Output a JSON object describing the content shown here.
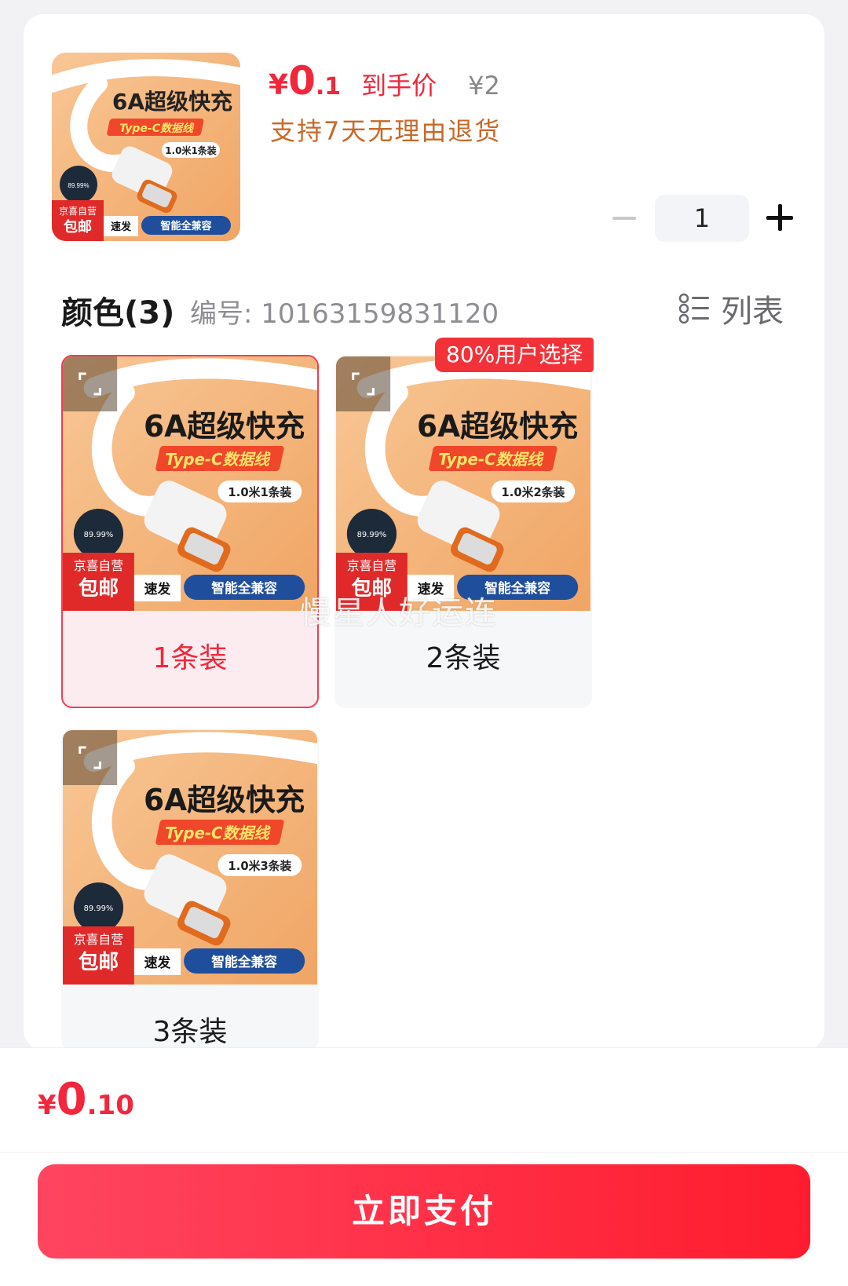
{
  "product": {
    "price_symbol": "¥",
    "price_int": "0",
    "price_dec": ".1",
    "price_tag": "到手价",
    "original_price": "¥2",
    "return_policy": "支持7天无理由退货",
    "quantity": "1",
    "thumb": {
      "title": "6A超级快充",
      "subtitle": "Type-C数据线",
      "spec": "1.0米1条装",
      "badge_top": "京喜自营",
      "badge_bottom": "包邮",
      "left_strip": "速发",
      "right_strip": "智能全兼容",
      "disc_text": "89.99%"
    }
  },
  "selector": {
    "title": "颜色(3)",
    "sku_id": "编号: 10163159831120",
    "list_label": "列表",
    "popular_badge": "80%用户选择",
    "options": [
      {
        "label": "1条装",
        "spec": "1.0米1条装",
        "selected": true
      },
      {
        "label": "2条装",
        "spec": "1.0米2条装",
        "selected": false
      },
      {
        "label": "3条装",
        "spec": "1.0米3条装",
        "selected": false
      }
    ],
    "image_common": {
      "title": "6A超级快充",
      "subtitle": "Type-C数据线",
      "badge_top": "京喜自营",
      "badge_bottom": "包邮",
      "left_strip": "速发",
      "right_strip": "智能全兼容",
      "disc_text": "89.99%"
    }
  },
  "watermark": "慢星人好运连",
  "checkout": {
    "total_symbol": "¥",
    "total_int": "0",
    "total_dec": ".10",
    "pay_label": "立即支付"
  },
  "colors": {
    "accent": "#f2273c",
    "orange_text": "#c8692a",
    "product_bg": "#f5b47a",
    "strip_blue": "#1f4e9c"
  }
}
